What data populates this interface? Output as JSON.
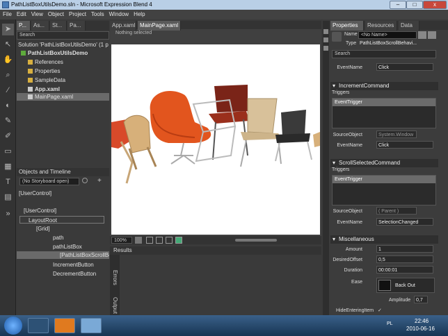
{
  "window": {
    "title": "PathListBoxUtilsDemo.sln - Microsoft Expression Blend 4",
    "minimize": "–",
    "maximize": "□",
    "close": "x"
  },
  "menu": [
    "File",
    "Edit",
    "View",
    "Object",
    "Project",
    "Tools",
    "Window",
    "Help"
  ],
  "leftTabs": [
    "P...",
    "As...",
    "St...",
    "Pa..."
  ],
  "search": {
    "placeholder": "Search"
  },
  "project": {
    "solution": "Solution 'PathListBoxUtilsDemo' (1 p",
    "root": "PathListBoxUtilsDemo",
    "items": [
      "References",
      "Properties",
      "SampleData",
      "App.xaml",
      "MainPage.xaml"
    ]
  },
  "objects": {
    "header": "Objects and Timeline",
    "storyboard": "(No Storyboard open)",
    "userControlTop": "[UserControl]",
    "tree": [
      {
        "label": "[UserControl]",
        "indent": 0
      },
      {
        "label": "LayoutRoot",
        "indent": 1
      },
      {
        "label": "[Grid]",
        "indent": 2
      },
      {
        "label": "path",
        "indent": 3
      },
      {
        "label": "pathListBox",
        "indent": 3
      },
      {
        "label": "[PathListBoxScrollBehav",
        "indent": 4
      },
      {
        "label": "IncrementButton",
        "indent": 3
      },
      {
        "label": "DecrementButton",
        "indent": 3
      }
    ]
  },
  "docTabs": [
    "App.xaml",
    "MainPage.xaml"
  ],
  "selection": "Nothing selected",
  "zoom": "100%",
  "results": {
    "header": "Results",
    "sideTabs": [
      "Errors",
      "Output"
    ]
  },
  "propTabs": [
    "Properties",
    "Resources",
    "Data"
  ],
  "props": {
    "nameLabel": "Name",
    "nameValue": "<No Name>",
    "typeLabel": "Type",
    "typeValue": "PathListBoxScrollBehavi...",
    "searchPlaceholder": "Search",
    "eventNameLabel": "EventName",
    "eventName1": "Click",
    "sectionIncrement": "IncrementCommand",
    "triggersLabel": "Triggers",
    "eventTrigger": "EventTrigger",
    "sourceObjectLabel": "SourceObject",
    "sourceObject1": "System.Window",
    "eventName2": "Click",
    "sectionScroll": "ScrollSelectedCommand",
    "sourceObject2": "( Parent )",
    "eventName3": "SelectionChanged",
    "sectionMisc": "Miscellaneous",
    "amountLabel": "Amount",
    "amountValue": "1",
    "desiredOffsetLabel": "DesiredOffset",
    "desiredOffsetValue": "0,5",
    "durationLabel": "Duration",
    "durationValue": "00:00:01",
    "easeLabel": "Ease",
    "easeValue": "Back Out",
    "amplitudeLabel": "Amplitude",
    "amplitudeValue": "0,7",
    "hideLabel": "HideEnteringItem"
  },
  "tray": {
    "lang": "PL",
    "time": "22:46",
    "date": "2010-06-16"
  }
}
